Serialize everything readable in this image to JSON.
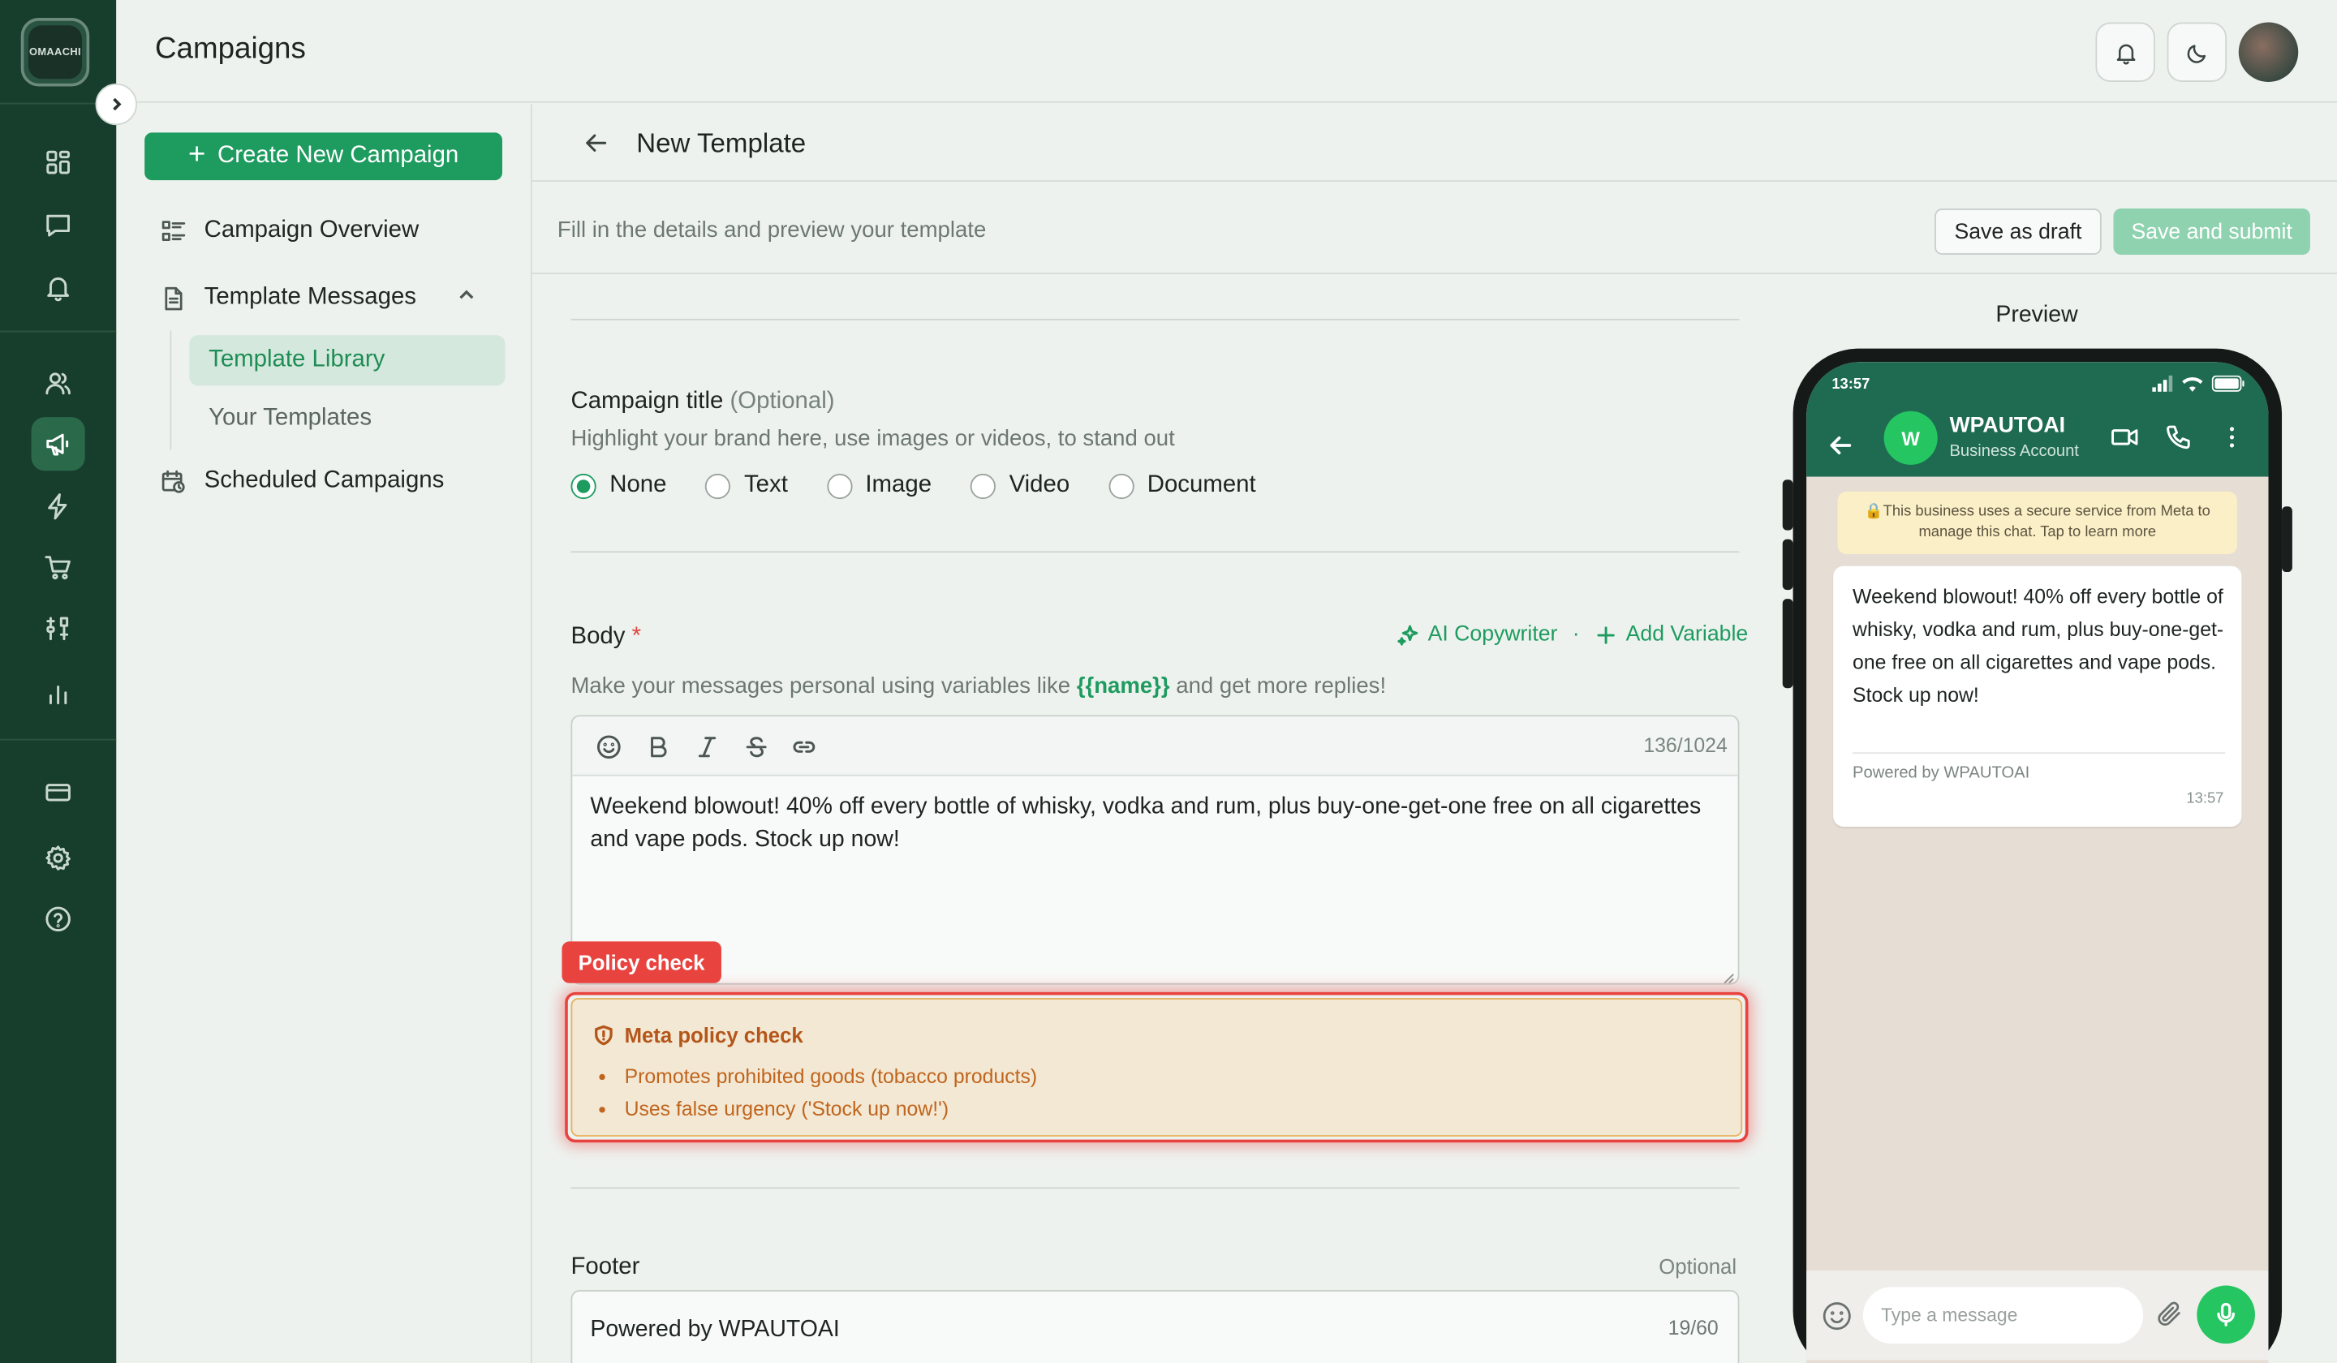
{
  "app": {
    "logo_text": "OMAACHI"
  },
  "header": {
    "title": "Campaigns"
  },
  "subnav": {
    "create_button": "Create New Campaign",
    "overview": "Campaign Overview",
    "template_messages": "Template Messages",
    "template_library": "Template Library",
    "your_templates": "Your Templates",
    "scheduled": "Scheduled Campaigns"
  },
  "main": {
    "title": "New Template",
    "subtitle": "Fill in the details and preview your template",
    "save_draft": "Save as draft",
    "save_submit": "Save and submit"
  },
  "campaign_title": {
    "label": "Campaign title",
    "optional": "(Optional)",
    "helper": "Highlight your brand here, use images or videos, to stand out",
    "options": [
      "None",
      "Text",
      "Image",
      "Video",
      "Document"
    ],
    "selected": "None"
  },
  "body": {
    "label": "Body",
    "required_mark": "*",
    "ai_copywriter": "AI Copywriter",
    "separator": "·",
    "add_variable": "Add Variable",
    "helper_before": "Make your messages personal using variables like ",
    "helper_var": "{{name}}",
    "helper_after": " and get more replies!",
    "counter": "136/1024",
    "text": "Weekend blowout! 40% off every bottle of whisky, vodka and rum, plus buy-one-get-one free on all cigarettes and vape pods. Stock up now!"
  },
  "policy": {
    "tag": "Policy check",
    "heading": "Meta policy check",
    "issues": [
      "Promotes prohibited goods (tobacco products)",
      "Uses false urgency ('Stock up now!')"
    ]
  },
  "footer_field": {
    "label": "Footer",
    "optional": "Optional",
    "value": "Powered by WPAUTOAI",
    "counter": "19/60"
  },
  "preview": {
    "label": "Preview",
    "status_time": "13:57",
    "business_name": "WPAUTOAI",
    "business_sub": "Business Account",
    "avatar_letter": "W",
    "notice": "🔒This business uses a secure service from Meta to manage this chat. Tap to learn more",
    "message": "Weekend blowout! 40% off every bottle of whisky, vodka and rum, plus buy-one-get-one free on all cigarettes and vape pods. Stock up now!",
    "message_footer": "Powered by WPAUTOAI",
    "message_time": "13:57",
    "input_placeholder": "Type a message"
  },
  "colors": {
    "brand_green": "#1e9b5f",
    "rail_bg": "#173d2c",
    "policy_red": "#e9433f",
    "whatsapp_header": "#1e6b52"
  },
  "icons": {
    "rail": [
      "grid-icon",
      "chat-icon",
      "bell-icon",
      "users-icon",
      "megaphone-icon",
      "bolt-icon",
      "cart-icon",
      "tool-icon",
      "bar-chart-icon",
      "card-icon",
      "gear-icon",
      "help-icon"
    ]
  }
}
